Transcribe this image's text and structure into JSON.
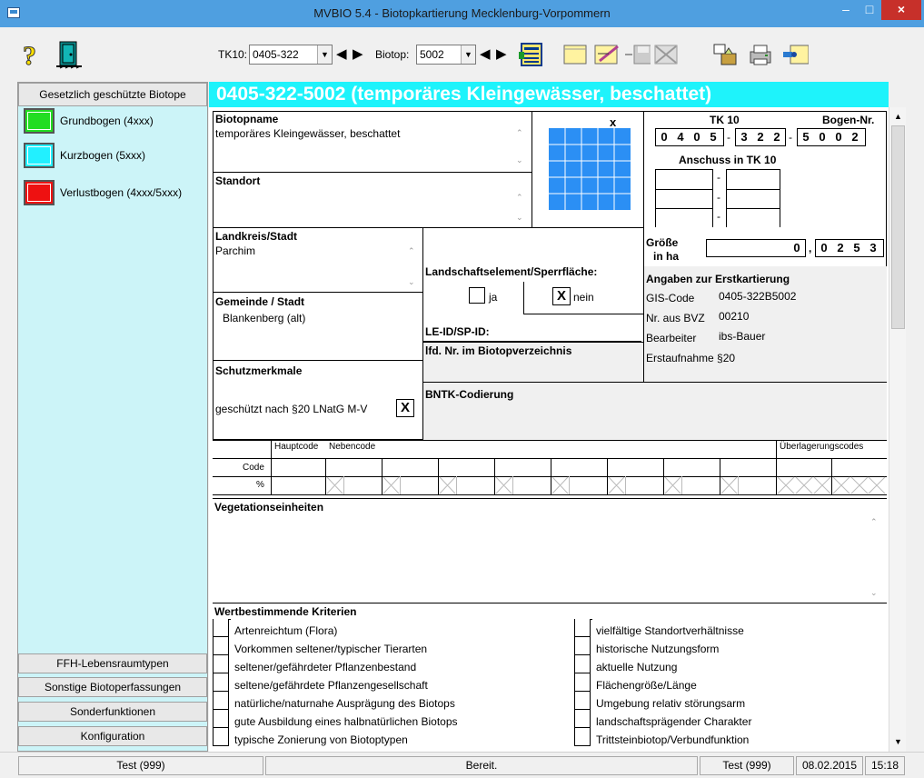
{
  "window": {
    "title": "MVBIO 5.4 - Biotopkartierung Mecklenburg-Vorpommern"
  },
  "toolbar": {
    "tk10_label": "TK10:",
    "tk10_value": "0405-322",
    "biotop_label": "Biotop:",
    "biotop_value": "5002"
  },
  "left_panel": {
    "header": "Gesetzlich geschützte Biotope",
    "items": [
      {
        "label": "Grundbogen (4xxx)",
        "color": "#22dd22"
      },
      {
        "label": "Kurzbogen (5xxx)",
        "color": "#22f0ff"
      },
      {
        "label": "Verlustbogen (4xxx/5xxx)",
        "color": "#ee1111"
      }
    ],
    "buttons": [
      "FFH-Lebensraumtypen",
      "Sonstige Biotoperfassungen",
      "Sonderfunktionen",
      "Konfiguration"
    ]
  },
  "main": {
    "heading": "0405-322-5002 (temporäres Kleingewässer, beschattet)",
    "biotopname_label": "Biotopname",
    "biotopname_value": "temporäres Kleingewässer, beschattet",
    "standort_label": "Standort",
    "grid_close": "x",
    "tk10_label": "TK 10",
    "bogen_label": "Bogen-Nr.",
    "tk_digits_a": [
      "0",
      "4",
      "0",
      "5"
    ],
    "tk_digits_b": [
      "3",
      "2",
      "2"
    ],
    "bogen_digits": [
      "5",
      "0",
      "0",
      "2"
    ],
    "dash": "-",
    "anschuss_label": "Anschuss in TK 10",
    "landkreis_label": "Landkreis/Stadt",
    "landkreis_value": "Parchim",
    "groesse_label_1": "Größe",
    "groesse_label_2": "in ha",
    "groesse_int": "0",
    "groesse_sep": ",",
    "groesse_dec": [
      "0",
      "2",
      "5",
      "3"
    ],
    "landschaft_label": "Landschaftselement/Sperrfläche:",
    "ja_label": "ja",
    "nein_label": "nein",
    "nein_mark": "X",
    "leid_label": "LE-ID/SP-ID:",
    "lfd_label": "lfd. Nr. im Biotopverzeichnis",
    "erst_label": "Angaben zur Erstkartierung",
    "gis_label": "GIS-Code",
    "gis_value": "0405-322B5002",
    "bvz_label": "Nr. aus BVZ",
    "bvz_value": "00210",
    "bearbeiter_label": "Bearbeiter",
    "bearbeiter_value": "ibs-Bauer",
    "erstaufnahme": "Erstaufnahme §20",
    "gemeinde_label": "Gemeinde / Stadt",
    "gemeinde_value": "Blankenberg (alt)",
    "schutz_label": "Schutzmerkmale",
    "schutz_text": "geschützt nach §20 LNatG M-V",
    "schutz_mark": "X",
    "bntk_label": "BNTK-Codierung",
    "hauptcode_label": "Hauptcode",
    "nebencode_label": "Nebencode",
    "ueberlagerung_label": "Überlagerungscodes",
    "code_label": "Code",
    "percent_label": "%",
    "vegetation_label": "Vegetationseinheiten",
    "kriterien_label": "Wertbestimmende Kriterien",
    "kriterien_left": [
      "Artenreichtum (Flora)",
      "Vorkommen seltener/typischer Tierarten",
      "seltener/gefährdeter Pflanzenbestand",
      "seltene/gefährdete Pflanzengesellschaft",
      "natürliche/naturnahe Ausprägung des Biotops",
      "gute Ausbildung eines halbnatürlichen Biotops",
      "typische Zonierung von Biotoptypen"
    ],
    "kriterien_right": [
      "vielfältige Standortverhältnisse",
      "historische Nutzungsform",
      "aktuelle Nutzung",
      "Flächengröße/Länge",
      "Umgebung relativ störungsarm",
      "landschaftsprägender Charakter",
      "Trittsteinbiotop/Verbundfunktion"
    ]
  },
  "statusbar": {
    "left": "Test (999)",
    "center": "Bereit.",
    "user": "Test (999)",
    "date": "08.02.2015",
    "time": "15:18"
  }
}
